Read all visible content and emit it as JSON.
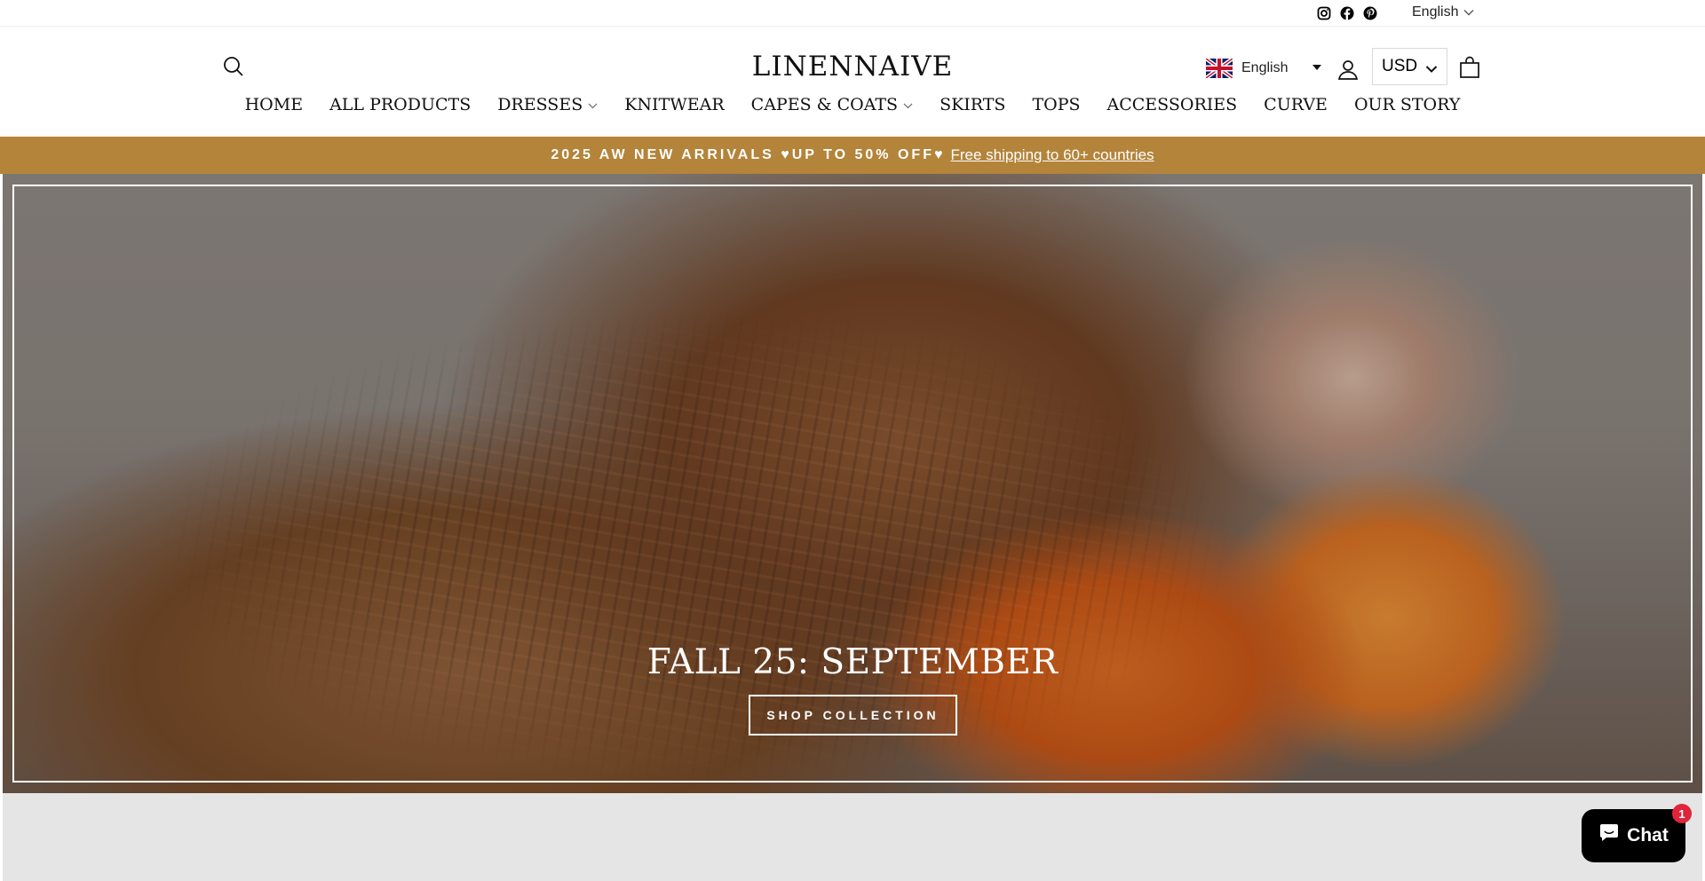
{
  "util_bar": {
    "social_icons": [
      "instagram-icon",
      "facebook-icon",
      "pinterest-icon"
    ],
    "language": "English"
  },
  "header": {
    "logo": "LINENNAIVE",
    "translate_language": "English",
    "currency": "USD"
  },
  "nav": [
    {
      "label": "HOME",
      "dropdown": false
    },
    {
      "label": "ALL PRODUCTS",
      "dropdown": false
    },
    {
      "label": "DRESSES",
      "dropdown": true
    },
    {
      "label": "KNITWEAR",
      "dropdown": false
    },
    {
      "label": "CAPES & COATS",
      "dropdown": true
    },
    {
      "label": "SKIRTS",
      "dropdown": false
    },
    {
      "label": "TOPS",
      "dropdown": false
    },
    {
      "label": "ACCESSORIES",
      "dropdown": false
    },
    {
      "label": "CURVE",
      "dropdown": false
    },
    {
      "label": "OUR STORY",
      "dropdown": false
    }
  ],
  "announcement": {
    "text": "2025 AW NEW ARRIVALS ♥UP TO 50% OFF♥",
    "link": "Free shipping to 60+ countries"
  },
  "hero": {
    "title": "FALL 25: SEPTEMBER",
    "button": "SHOP COLLECTION"
  },
  "chat": {
    "label": "Chat",
    "badge": "1"
  },
  "colors": {
    "announcement_bg": "#b3843a",
    "chat_bg": "#000000",
    "badge_bg": "#e0253b"
  }
}
